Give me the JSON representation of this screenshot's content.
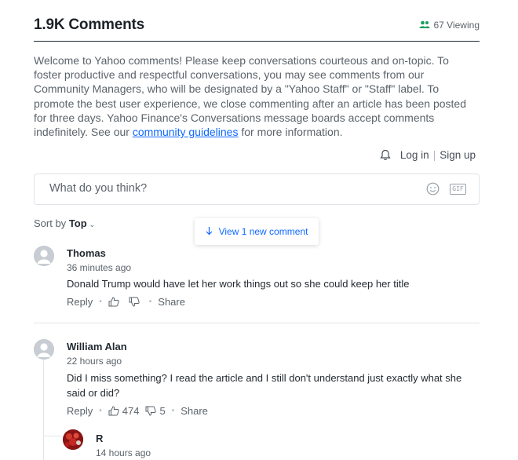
{
  "header": {
    "title": "1.9K Comments",
    "viewing": "67 Viewing",
    "viewing_icon": "users-icon"
  },
  "intro": {
    "text": "Welcome to Yahoo comments! Please keep conversations courteous and on-topic. To foster productive and respectful conversations, you may see comments from our Community Managers, who will be designated by a \"Yahoo Staff\" or \"Staff\" label. To promote the best user experience, we close commenting after an article has been posted for three days. Yahoo Finance's Conversations message boards accept comments indefinitely. See our ",
    "link": "community guidelines",
    "tail": " for more information."
  },
  "auth": {
    "login": "Log in",
    "divider": "|",
    "signup": "Sign up"
  },
  "composer": {
    "placeholder": "What do you think?",
    "gif_label": "GIF"
  },
  "sort": {
    "label": "Sort by",
    "value": "Top"
  },
  "new_comments": {
    "label": "View 1 new comment"
  },
  "comments": [
    {
      "name": "Thomas",
      "time": "36 minutes ago",
      "body": "Donald Trump would have let her work things out so she could keep her title",
      "reply": "Reply",
      "share": "Share",
      "upvotes": "",
      "downvotes": ""
    },
    {
      "name": "William Alan",
      "time": "22 hours ago",
      "body": "Did I miss something?  I read the article and I still don't understand just exactly what she said or did?",
      "reply": "Reply",
      "share": "Share",
      "upvotes": "474",
      "downvotes": "5"
    },
    {
      "name": "R",
      "time": "14 hours ago"
    }
  ],
  "colors": {
    "accent": "#0f69ff",
    "viewing_icon": "#1a9e5b",
    "text": "#232a31",
    "muted": "#5b636a",
    "border": "#e0e4e9"
  }
}
